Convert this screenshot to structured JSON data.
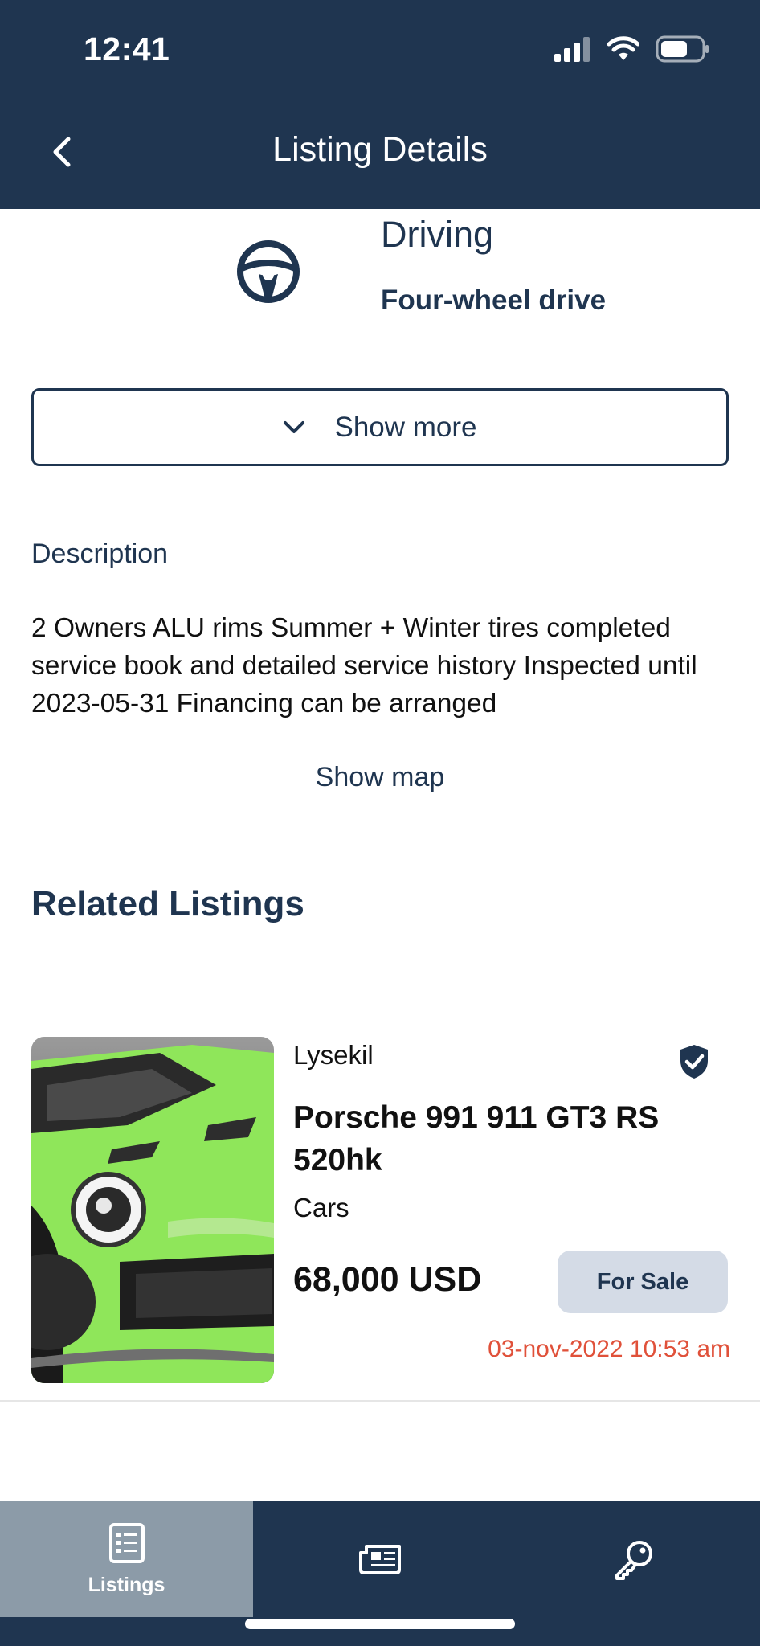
{
  "status_bar": {
    "time": "12:41"
  },
  "nav": {
    "title": "Listing Details"
  },
  "spec": {
    "label": "Driving",
    "value": "Four-wheel drive",
    "icon": "steering-wheel-icon"
  },
  "show_more": {
    "label": "Show more"
  },
  "description": {
    "heading": "Description",
    "text": "2 Owners ALU rims Summer + Winter tires completed service book and detailed service history Inspected until 2023-05-31 Financing can be arranged"
  },
  "show_map": {
    "label": "Show map"
  },
  "related": {
    "heading": "Related Listings",
    "items": [
      {
        "location": "Lysekil",
        "title": "Porsche 991 911 GT3 RS 520hk",
        "category": "Cars",
        "price": "68,000 USD",
        "status": "For Sale",
        "date": "03-nov-2022 10:53 am",
        "verified": true
      }
    ]
  },
  "tabbar": {
    "tabs": [
      {
        "label": "Listings",
        "icon": "listings-icon",
        "active": true
      },
      {
        "label": "",
        "icon": "news-icon",
        "active": false
      },
      {
        "label": "",
        "icon": "key-icon",
        "active": false
      }
    ]
  },
  "colors": {
    "primary": "#1f3550",
    "active_tab": "#8c9ba8",
    "badge_bg": "#d4dbe6",
    "date": "#e0513a"
  }
}
